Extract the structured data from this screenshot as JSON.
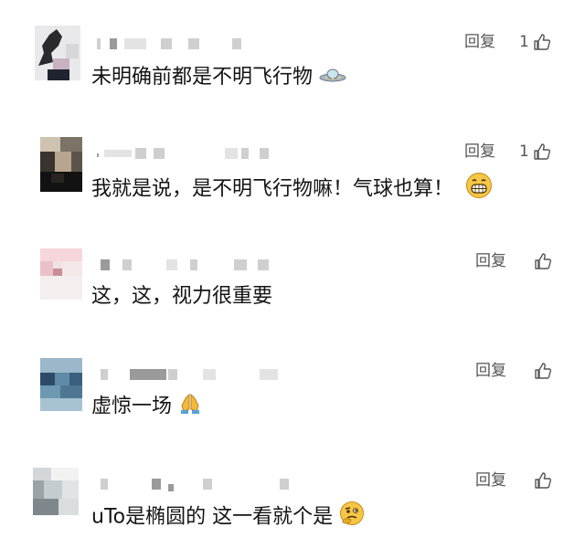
{
  "reply_label": "回复",
  "comments": [
    {
      "text": "未明确前都是不明飞行物",
      "emoji": "ufo-emoji",
      "likes": "1"
    },
    {
      "text": "我就是说，是不明飞行物嘛！气球也算！",
      "emoji": "grin-emoji",
      "likes": "1"
    },
    {
      "text": "这，这，视力很重要",
      "emoji": "",
      "likes": ""
    },
    {
      "text": "虚惊一场",
      "emoji": "pray-emoji",
      "likes": ""
    },
    {
      "text": "uTo是椭圆的 这一看就个是",
      "emoji": "thinking-emoji",
      "likes": ""
    }
  ]
}
